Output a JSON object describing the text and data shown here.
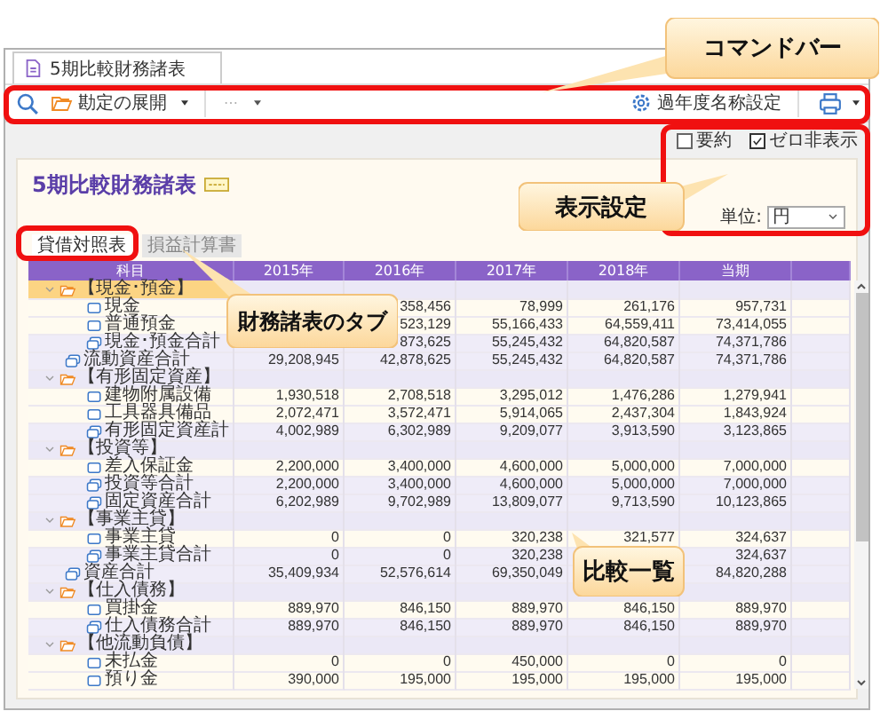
{
  "document_tab": {
    "label": "5期比較財務諸表"
  },
  "toolbar": {
    "expand_button": {
      "label": "勘定の展開"
    },
    "name_settings_button": {
      "label": "過年度名称設定"
    }
  },
  "options": [
    {
      "label": "要約",
      "checked": false
    },
    {
      "label": "ゼロ非表示",
      "checked": true
    }
  ],
  "report_title": "5期比較財務諸表",
  "unit": {
    "label": "単位:",
    "value": "円"
  },
  "report_tabs": [
    {
      "label": "貸借対照表",
      "selected": true
    },
    {
      "label": "損益計算書",
      "selected": false
    }
  ],
  "table": {
    "columns": [
      "科目",
      "2015年",
      "2016年",
      "2017年",
      "2018年",
      "当期"
    ],
    "rows": [
      {
        "kind": "group",
        "label": "【現金･預金】",
        "selected": true,
        "expanded": true,
        "children": [
          {
            "kind": "item",
            "label": "現金",
            "values": {
              "fy2016": "358,456",
              "fy2017": "78,999",
              "fy2018": "261,176",
              "current": "957,731"
            }
          },
          {
            "kind": "item",
            "label": "普通預金",
            "values": {
              "fy2016": "523,129",
              "fy2017": "55,166,433",
              "fy2018": "64,559,411",
              "current": "73,414,055"
            }
          },
          {
            "kind": "total",
            "label": "現金･預金合計",
            "values": {
              "fy2016": "873,625",
              "fy2017": "55,245,432",
              "fy2018": "64,820,587",
              "current": "74,371,786"
            }
          }
        ]
      },
      {
        "kind": "total",
        "label": "流動資産合計",
        "values": {
          "fy2015": "29,208,945",
          "fy2016": "42,878,625",
          "fy2017": "55,245,432",
          "fy2018": "64,820,587",
          "current": "74,371,786"
        }
      },
      {
        "kind": "group",
        "label": "【有形固定資産】",
        "selected": false,
        "expanded": true,
        "children": [
          {
            "kind": "item",
            "label": "建物附属設備",
            "values": {
              "fy2015": "1,930,518",
              "fy2016": "2,708,518",
              "fy2017": "3,295,012",
              "fy2018": "1,476,286",
              "current": "1,279,941"
            }
          },
          {
            "kind": "item",
            "label": "工具器具備品",
            "values": {
              "fy2015": "2,072,471",
              "fy2016": "3,572,471",
              "fy2017": "5,914,065",
              "fy2018": "2,437,304",
              "current": "1,843,924"
            }
          },
          {
            "kind": "total",
            "label": "有形固定資産計",
            "values": {
              "fy2015": "4,002,989",
              "fy2016": "6,302,989",
              "fy2017": "9,209,077",
              "fy2018": "3,913,590",
              "current": "3,123,865"
            }
          }
        ]
      },
      {
        "kind": "group",
        "label": "【投資等】",
        "selected": false,
        "expanded": true,
        "children": [
          {
            "kind": "item",
            "label": "差入保証金",
            "values": {
              "fy2015": "2,200,000",
              "fy2016": "3,400,000",
              "fy2017": "4,600,000",
              "fy2018": "5,000,000",
              "current": "7,000,000"
            }
          },
          {
            "kind": "total",
            "label": "投資等合計",
            "values": {
              "fy2015": "2,200,000",
              "fy2016": "3,400,000",
              "fy2017": "4,600,000",
              "fy2018": "5,000,000",
              "current": "7,000,000"
            }
          },
          {
            "kind": "total",
            "label": "固定資産合計",
            "values": {
              "fy2015": "6,202,989",
              "fy2016": "9,702,989",
              "fy2017": "13,809,077",
              "fy2018": "9,713,590",
              "current": "10,123,865"
            }
          }
        ]
      },
      {
        "kind": "group",
        "label": "【事業主貸】",
        "selected": false,
        "expanded": true,
        "children": [
          {
            "kind": "item",
            "label": "事業主貸",
            "values": {
              "fy2015": "0",
              "fy2016": "0",
              "fy2017": "320,238",
              "fy2018": "321,577",
              "current": "324,637"
            }
          },
          {
            "kind": "total",
            "label": "事業主貸合計",
            "values": {
              "fy2015": "0",
              "fy2016": "0",
              "fy2017": "320,238",
              "current": "324,637"
            }
          }
        ]
      },
      {
        "kind": "total",
        "label": "資産合計",
        "values": {
          "fy2015": "35,409,934",
          "fy2016": "52,576,614",
          "fy2017": "69,350,049",
          "current": "84,820,288"
        }
      },
      {
        "kind": "group",
        "label": "【仕入債務】",
        "selected": false,
        "expanded": true,
        "children": [
          {
            "kind": "item",
            "label": "買掛金",
            "values": {
              "fy2015": "889,970",
              "fy2016": "846,150",
              "fy2017": "889,970",
              "fy2018": "846,150",
              "current": "889,970"
            }
          },
          {
            "kind": "total",
            "label": "仕入債務合計",
            "values": {
              "fy2015": "889,970",
              "fy2016": "846,150",
              "fy2017": "889,970",
              "fy2018": "846,150",
              "current": "889,970"
            }
          }
        ]
      },
      {
        "kind": "group",
        "label": "【他流動負債】",
        "selected": false,
        "expanded": true,
        "children": [
          {
            "kind": "item",
            "label": "未払金",
            "values": {
              "fy2015": "0",
              "fy2016": "0",
              "fy2017": "450,000",
              "fy2018": "0",
              "current": "0"
            }
          },
          {
            "kind": "item",
            "label": "預り金",
            "values": {
              "fy2015": "390,000",
              "fy2016": "195,000",
              "fy2017": "195,000",
              "fy2018": "195,000",
              "current": "195,000"
            }
          }
        ]
      }
    ]
  },
  "callouts": [
    "コマンドバー",
    "表示設定",
    "財務諸表のタブ",
    "比較一覧"
  ]
}
